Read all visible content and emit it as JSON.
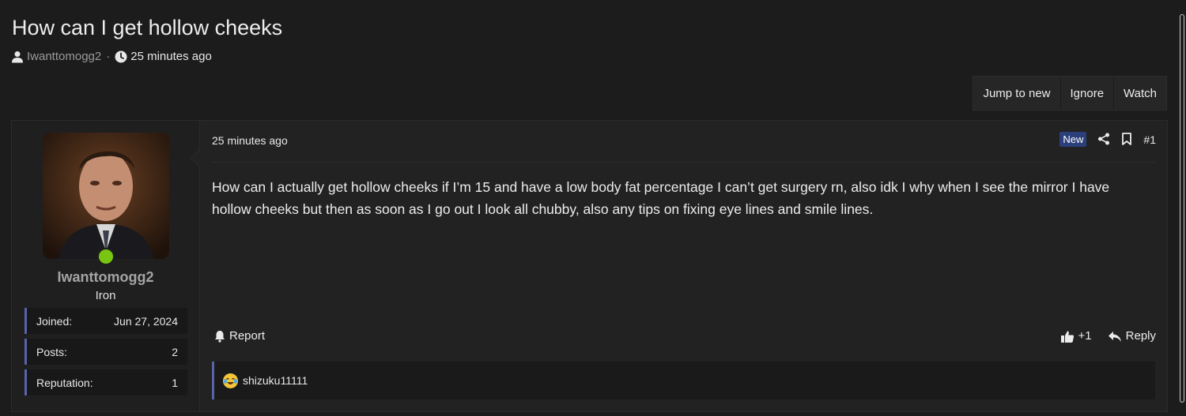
{
  "thread": {
    "title": "How can I get hollow cheeks",
    "author": "Iwanttomogg2",
    "separator": "·",
    "time": "25 minutes ago"
  },
  "actions": [
    {
      "label": "Jump to new"
    },
    {
      "label": "Ignore"
    },
    {
      "label": "Watch"
    }
  ],
  "post": {
    "time": "25 minutes ago",
    "badge": "New",
    "number": "#1",
    "body": "How can I actually get hollow cheeks if I’m 15 and have a low body fat percentage I can’t get surgery rn, also idk I why when I see the mirror I have hollow cheeks but then as soon as I go out I look all chubby, also any tips on fixing eye lines and smile lines.",
    "report_label": "Report",
    "like_label": "+1",
    "reply_label": "Reply",
    "reactions": [
      {
        "user": "shizuku11111",
        "icon": "crying-laughing-emoji-icon"
      }
    ]
  },
  "user": {
    "name": "Iwanttomogg2",
    "title": "Iron",
    "status": "online",
    "stats": [
      {
        "label": "Joined:",
        "value": "Jun 27, 2024"
      },
      {
        "label": "Posts:",
        "value": "2"
      },
      {
        "label": "Reputation:",
        "value": "1"
      }
    ]
  },
  "colors": {
    "background": "#1c1c1c",
    "panel": "#222222",
    "accent": "#5b62a8",
    "new_badge": "#2b3f7a",
    "online": "#7ac412"
  }
}
